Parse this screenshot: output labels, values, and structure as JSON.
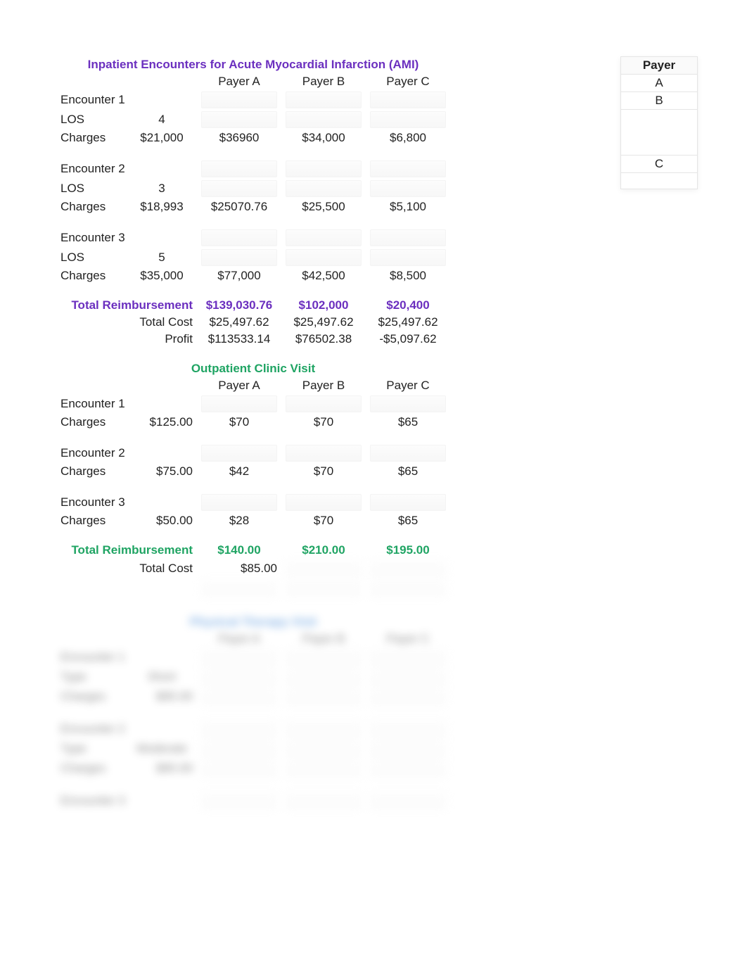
{
  "labels": {
    "payerA": "Payer A",
    "payerB": "Payer B",
    "payerC": "Payer C",
    "encounter1": "Encounter 1",
    "encounter2": "Encounter 2",
    "encounter3": "Encounter 3",
    "los": "LOS",
    "charges": "Charges",
    "totalReimb": "Total Reimbursement",
    "totalCost": "Total Cost",
    "profit": "Profit"
  },
  "inpatient": {
    "title": "Inpatient Encounters for Acute Myocardial Infarction (AMI)",
    "e1": {
      "los": "4",
      "charges": "$21,000",
      "a": "$36960",
      "b": "$34,000",
      "c": "$6,800"
    },
    "e2": {
      "los": "3",
      "charges": "$18,993",
      "a": "$25070.76",
      "b": "$25,500",
      "c": "$5,100"
    },
    "e3": {
      "los": "5",
      "charges": "$35,000",
      "a": "$77,000",
      "b": "$42,500",
      "c": "$8,500"
    },
    "totalReimb": {
      "a": "$139,030.76",
      "b": "$102,000",
      "c": "$20,400"
    },
    "totalCost": {
      "a": "$25,497.62",
      "b": "$25,497.62",
      "c": "$25,497.62"
    },
    "profit": {
      "a": "$113533.14",
      "b": "$76502.38",
      "c": "-$5,097.62"
    }
  },
  "outpatient": {
    "title": "Outpatient Clinic Visit",
    "e1": {
      "charges": "$125.00",
      "a": "$70",
      "b": "$70",
      "c": "$65"
    },
    "e2": {
      "charges": "$75.00",
      "a": "$42",
      "b": "$70",
      "c": "$65"
    },
    "e3": {
      "charges": "$50.00",
      "a": "$28",
      "b": "$70",
      "c": "$65"
    },
    "totalReimb": {
      "a": "$140.00",
      "b": "$210.00",
      "c": "$195.00"
    },
    "totalCost": {
      "a": "$85.00"
    }
  },
  "third": {
    "title": "Physical Therapy Visit",
    "hdr": {
      "a": "Payer A",
      "b": "Payer B",
      "c": "Payer C"
    },
    "e1": {
      "label": "Encounter 1",
      "row1l": "Type",
      "row1v": "Short",
      "row2l": "Charges",
      "row2v": "$95.00"
    },
    "e2": {
      "label": "Encounter 2",
      "row1l": "Type",
      "row1v": "Moderate",
      "row2l": "Charges",
      "row2v": "$95.00"
    },
    "e3": {
      "label": "Encounter 3"
    }
  },
  "side": {
    "hdr": "Payer",
    "a": "A",
    "b": "B",
    "c": "C"
  }
}
